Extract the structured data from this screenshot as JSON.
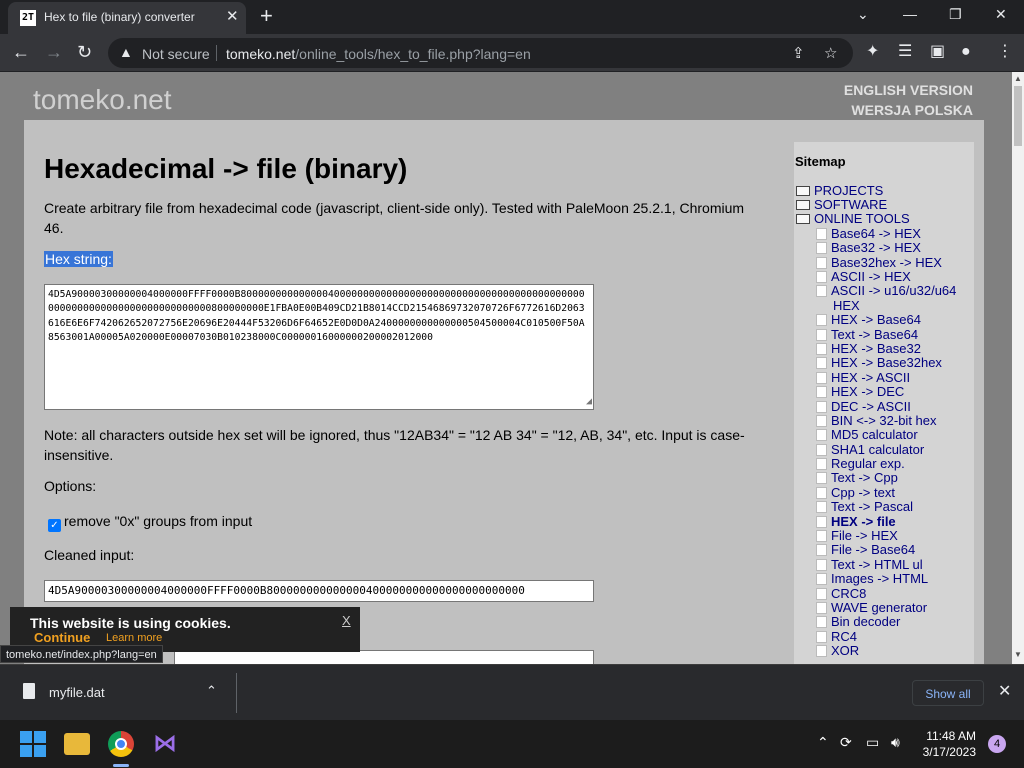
{
  "browser": {
    "tab_title": "Hex to file (binary) converter",
    "favicon_text": "2T",
    "not_secure": "Not secure",
    "url_host": "tomeko.net",
    "url_path": "/online_tools/hex_to_file.php?lang=en"
  },
  "site": {
    "logo": "tomeko.net",
    "lang_en": "ENGLISH VERSION",
    "lang_pl": "WERSJA POLSKA"
  },
  "page": {
    "title": "Hexadecimal -> file (binary)",
    "description": "Create arbitrary file from hexadecimal code (javascript, client-side only). Tested with PaleMoon 25.2.1, Chromium 46.",
    "hex_label": "Hex string:",
    "hex_value": "4D5A90000300000004000000FFFF0000B800000000000000400000000000000000000000000000000000000000000000000000000000000000000000800000000E1FBA0E00B409CD21B8014CCD21546869732070726F6772616D2063616E6E6F742062652072756E20696E20444F53206D6F64652E0D0D0A2400000000000000504500004C010500F50A8563001A00005A020000E00007030B010238000C00000016000000200002012000",
    "note": "Note: all characters outside hex set will be ignored, thus \"12AB34\" = \"12 AB 34\" = \"12, AB, 34\", etc. Input is case-insensitive.",
    "options_label": "Options:",
    "remove_0x_label": "remove \"0x\" groups from input",
    "cleaned_label": "Cleaned input:",
    "cleaned_value": "4D5A90000300000004000000FFFF0000B800000000000000400000000000000000000000"
  },
  "sitemap": {
    "title": "Sitemap",
    "folders": [
      "PROJECTS",
      "SOFTWARE",
      "ONLINE TOOLS"
    ],
    "items": [
      "Base64 -> HEX",
      "Base32 -> HEX",
      "Base32hex -> HEX",
      "ASCII -> HEX",
      "ASCII -> u16/u32/u64",
      "HEX",
      "HEX -> Base64",
      "Text -> Base64",
      "HEX -> Base32",
      "HEX -> Base32hex",
      "HEX -> ASCII",
      "HEX -> DEC",
      "DEC -> ASCII",
      "BIN <-> 32-bit hex",
      "MD5 calculator",
      "SHA1 calculator",
      "Regular exp.",
      "Text -> Cpp",
      "Cpp -> text",
      "Text -> Pascal",
      "HEX -> file",
      "File -> HEX",
      "File -> Base64",
      "Text -> HTML ul",
      "Images -> HTML",
      "CRC8",
      "WAVE generator",
      "Bin decoder",
      "RC4",
      "XOR"
    ]
  },
  "cookie": {
    "text": "This website is using cookies.",
    "close": "X",
    "continue": "Continue",
    "learn_more": "Learn more"
  },
  "status_url": "tomeko.net/index.php?lang=en",
  "download": {
    "filename": "myfile.dat",
    "show_all": "Show all"
  },
  "taskbar": {
    "time": "11:48 AM",
    "date": "3/17/2023",
    "notifications": "4"
  }
}
